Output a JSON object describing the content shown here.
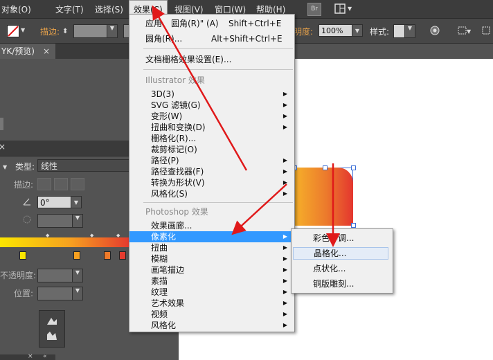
{
  "menubar": {
    "items": [
      "对象(O)",
      "文字(T)",
      "选择(S)",
      "效果(C)",
      "视图(V)",
      "窗口(W)",
      "帮助(H)"
    ],
    "br_label": "Br"
  },
  "control_bar": {
    "stroke_label": "描边:",
    "opacity_label": "明度:",
    "opacity_value": "100%",
    "style_label": "样式:"
  },
  "document_tab": {
    "label": "YK/预览)",
    "close": "×"
  },
  "gradient_panel": {
    "type_label": "类型:",
    "type_value": "线性",
    "stroke_label": "描边:",
    "angle_value": "0°",
    "opacity_label": "不透明度:",
    "position_label": "位置:"
  },
  "effect_menu": {
    "apply_label": "应用",
    "apply_rest": "圆角(R)\"  (A)",
    "apply_shortcut": "Shift+Ctrl+E",
    "roundcorner_label": "圆角(R)...",
    "roundcorner_shortcut": "Alt+Shift+Ctrl+E",
    "raster_settings": "文档栅格效果设置(E)...",
    "illustrator_header": "Illustrator 效果",
    "illustrator_items": [
      "3D(3)",
      "SVG 滤镜(G)",
      "变形(W)",
      "扭曲和变换(D)",
      "栅格化(R)...",
      "裁剪标记(O)",
      "路径(P)",
      "路径查找器(F)",
      "转换为形状(V)",
      "风格化(S)"
    ],
    "photoshop_header": "Photoshop 效果",
    "photoshop_items": [
      "效果画廊...",
      "像素化",
      "扭曲",
      "模糊",
      "画笔描边",
      "素描",
      "纹理",
      "艺术效果",
      "视频",
      "风格化"
    ]
  },
  "pixelate_submenu": {
    "items": [
      "彩色半调...",
      "晶格化...",
      "点状化...",
      "铜版雕刻..."
    ]
  },
  "colors": {
    "highlight": "#3399ff",
    "arrow": "#e0191a"
  }
}
